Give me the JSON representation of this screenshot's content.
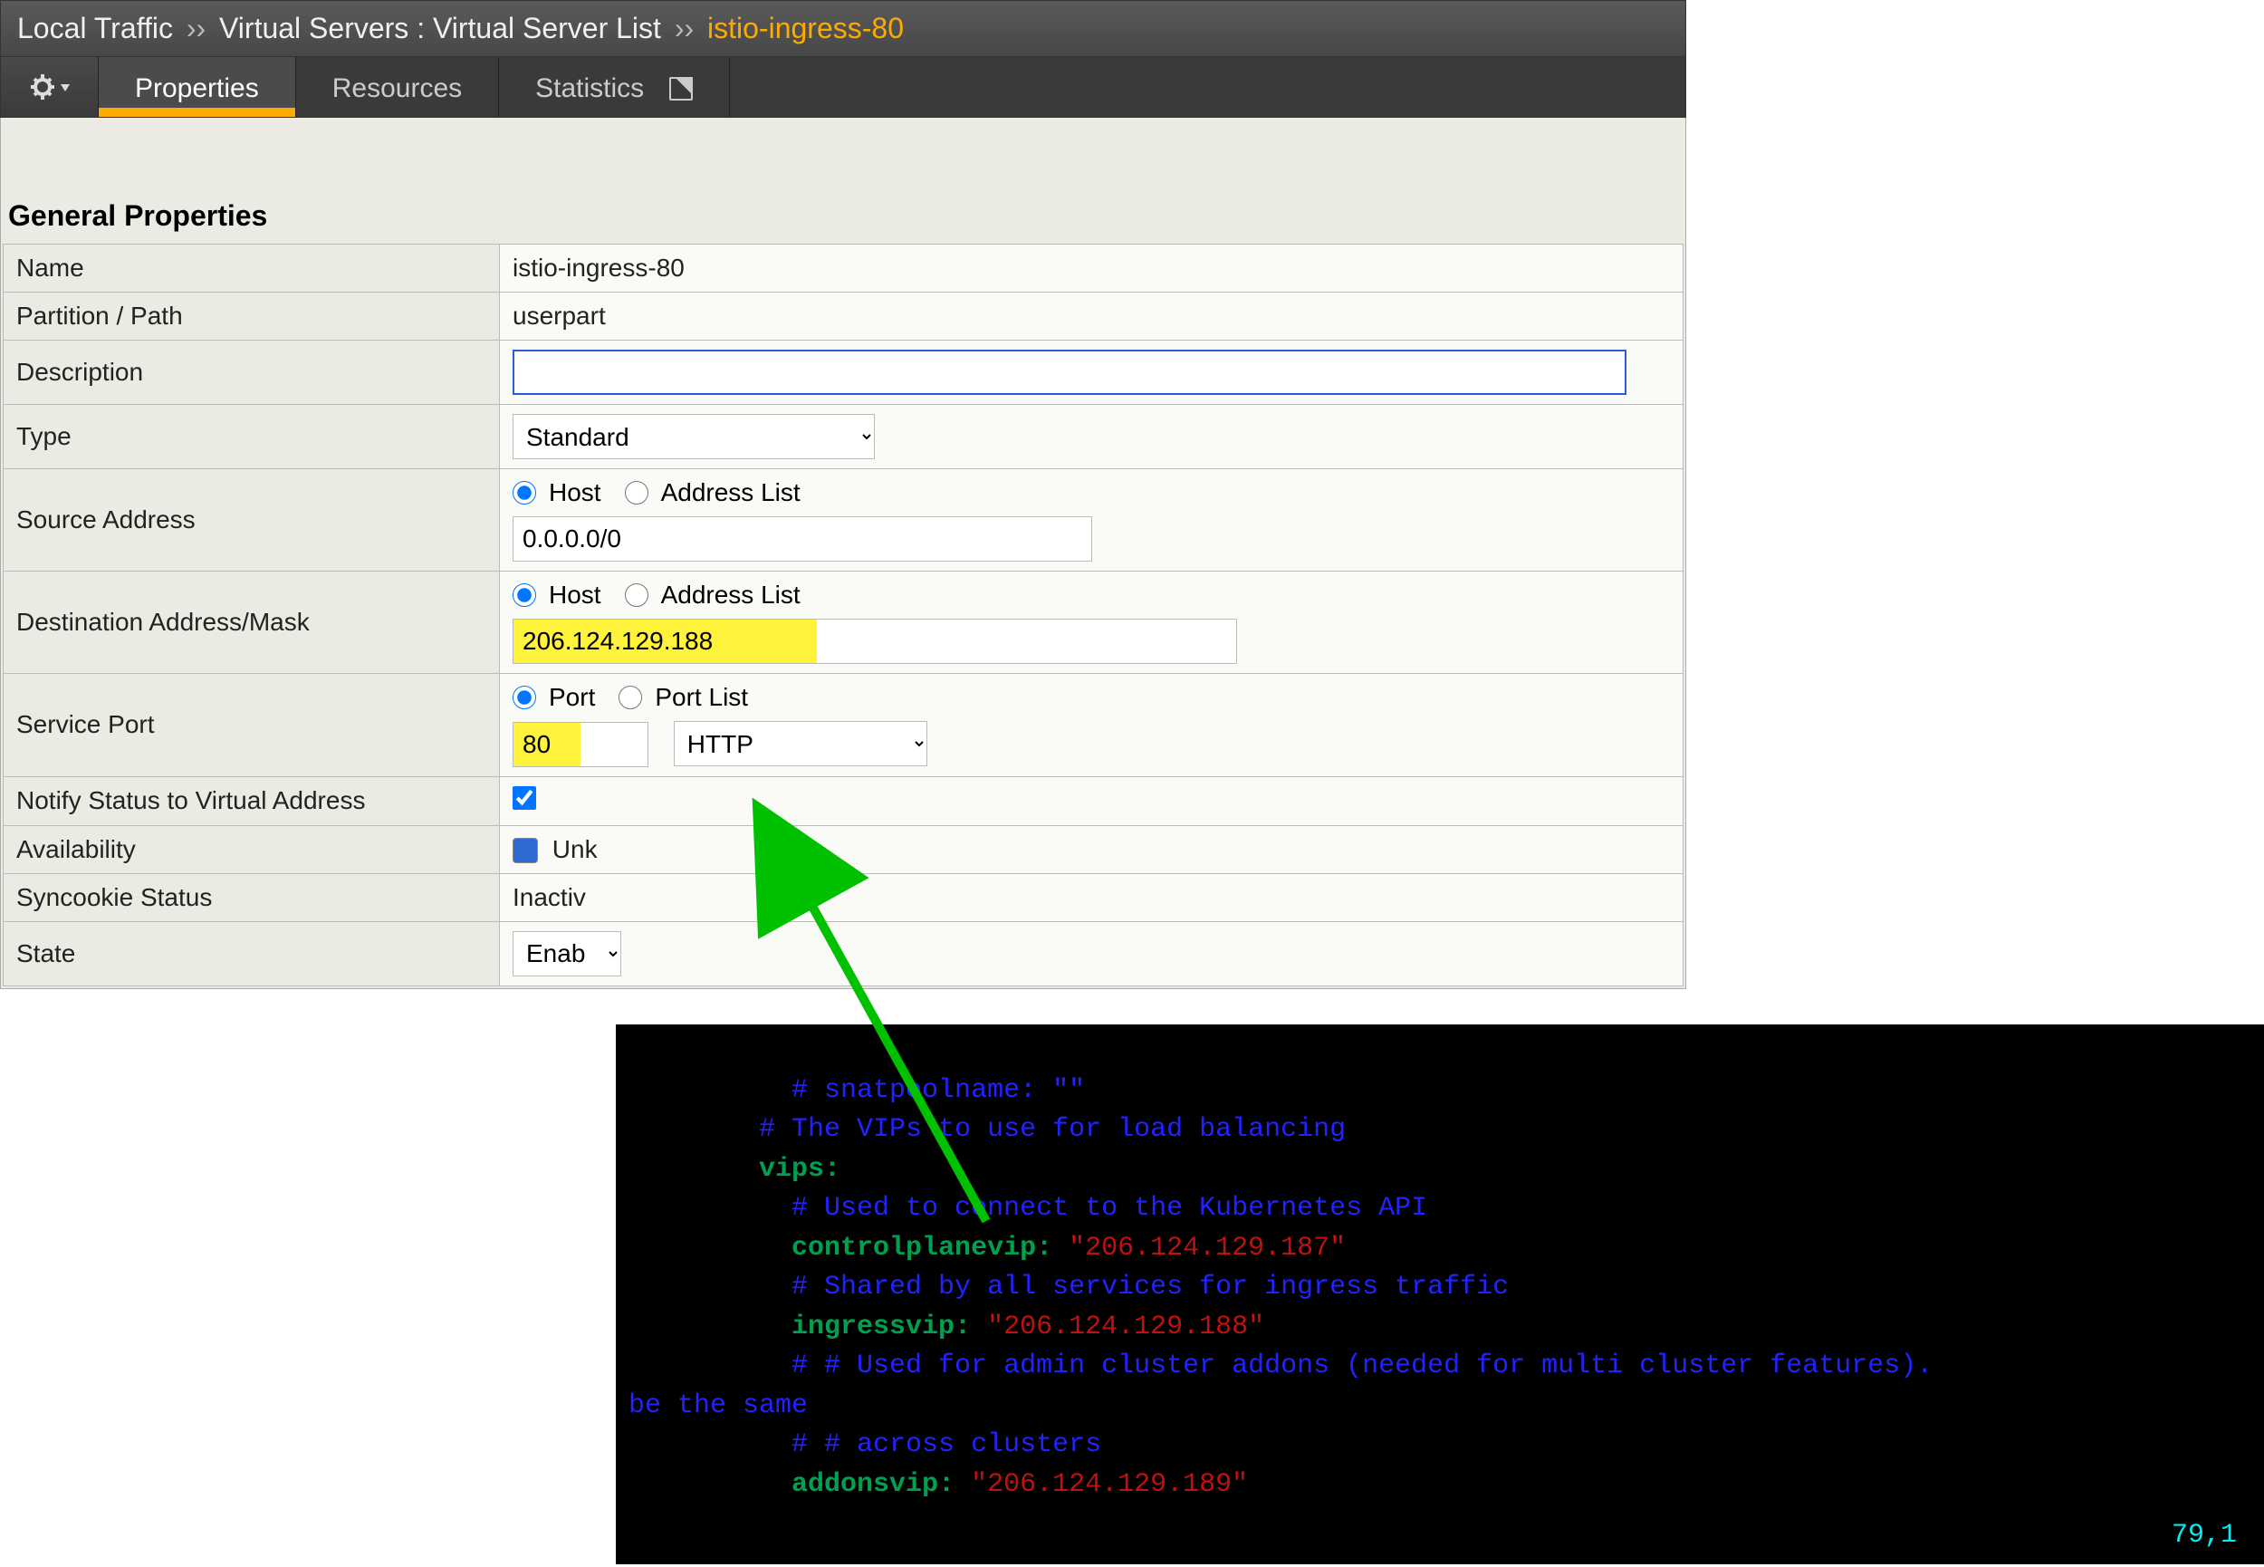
{
  "breadcrumb": {
    "root": "Local Traffic",
    "section": "Virtual Servers : Virtual Server List",
    "item": "istio-ingress-80",
    "sep": "››"
  },
  "tabs": {
    "properties": "Properties",
    "resources": "Resources",
    "statistics": "Statistics"
  },
  "heading": "General Properties",
  "rows": {
    "name": {
      "label": "Name",
      "value": "istio-ingress-80"
    },
    "partition": {
      "label": "Partition / Path",
      "value": "userpart"
    },
    "description": {
      "label": "Description",
      "value": ""
    },
    "type": {
      "label": "Type",
      "value": "Standard"
    },
    "source": {
      "label": "Source Address",
      "radio1": "Host",
      "radio2": "Address List",
      "value": "0.0.0.0/0"
    },
    "dest": {
      "label": "Destination Address/Mask",
      "radio1": "Host",
      "radio2": "Address List",
      "value": "206.124.129.188"
    },
    "port": {
      "label": "Service Port",
      "radio1": "Port",
      "radio2": "Port List",
      "num": "80",
      "proto": "HTTP"
    },
    "notify": {
      "label": "Notify Status to Virtual Address"
    },
    "availability": {
      "label": "Availability",
      "value": "Unk"
    },
    "syncookie": {
      "label": "Syncookie Status",
      "value": "Inactiv"
    },
    "state": {
      "label": "State",
      "value": "Enab"
    }
  },
  "terminal": {
    "l1_indent": "          ",
    "l1": "# snatpoolname: \"\"",
    "l2_indent": "        ",
    "l2": "# The VIPs to use for load balancing",
    "l3_indent": "        ",
    "l3": "vips:",
    "l4_indent": "          ",
    "l4": "# Used to connect to the Kubernetes API",
    "l5_indent": "          ",
    "l5k": "controlplanevip:",
    "l5v": " \"206.124.129.187\"",
    "l6_indent": "          ",
    "l6": "# Shared by all services for ingress traffic",
    "l7_indent": "          ",
    "l7k": "ingressvip:",
    "l7v": " \"206.124.129.188\"",
    "l8_indent": "          ",
    "l8": "# # Used for admin cluster addons (needed for multi cluster features).",
    "l8b": "be the same",
    "l9_indent": "          ",
    "l9": "# # across clusters",
    "l10_indent": "          ",
    "l10k": "addonsvip:",
    "l10v": " \"206.124.129.189\"",
    "cursor": "79,1"
  }
}
